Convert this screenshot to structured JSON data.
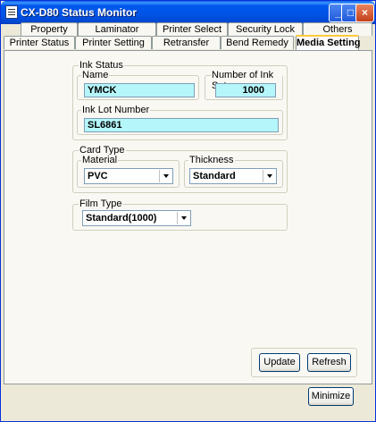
{
  "window": {
    "title": "CX-D80 Status Monitor"
  },
  "titlebar_buttons": {
    "minimize": "_",
    "maximize": "□",
    "close": "×"
  },
  "tabs_back": [
    "Property",
    "Laminator",
    "Printer Select",
    "Security Lock",
    "Others"
  ],
  "tabs_front": [
    "Printer Status",
    "Printer Setting",
    "Retransfer",
    "Bend Remedy",
    "Media Setting"
  ],
  "active_tab": "Media Setting",
  "ink_status": {
    "label": "Ink Status",
    "name_label": "Name",
    "name_value": "YMCK",
    "sets_label": "Number of Ink Sets",
    "sets_value": "1000",
    "lot_label": "Ink Lot Number",
    "lot_value": "SL6861"
  },
  "card_type": {
    "label": "Card Type",
    "material_label": "Material",
    "material_value": "PVC",
    "thickness_label": "Thickness",
    "thickness_value": "Standard"
  },
  "film_type": {
    "label": "Film Type",
    "value": "Standard(1000)"
  },
  "buttons": {
    "update": "Update",
    "refresh": "Refresh",
    "minimize": "Minimize"
  }
}
